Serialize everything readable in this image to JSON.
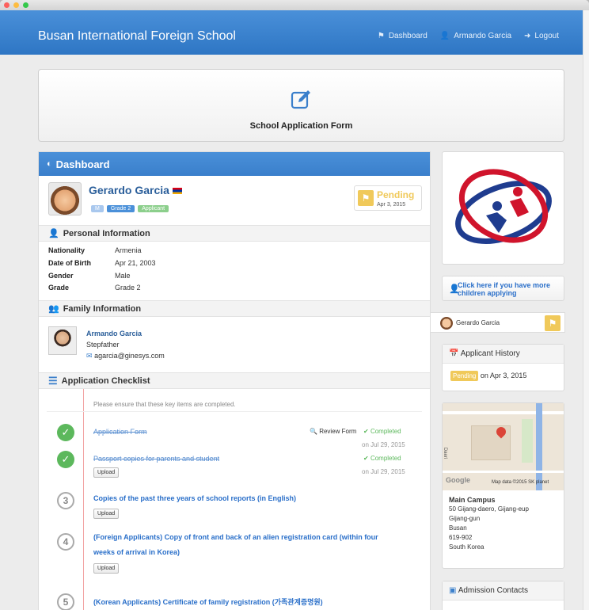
{
  "window": {
    "dot_colors": [
      "#fc605c",
      "#fdbc40",
      "#34c84a"
    ]
  },
  "navbar": {
    "brand": "Busan International Foreign School",
    "links": [
      {
        "icon": "flag-icon",
        "label": "Dashboard"
      },
      {
        "icon": "user-icon",
        "label": "Armando Garcia"
      },
      {
        "icon": "logout-icon",
        "label": "Logout"
      }
    ]
  },
  "hero": {
    "title": "School Application Form",
    "icon": "edit-icon"
  },
  "dashboard": {
    "title": "Dashboard",
    "student": {
      "name": "Gerardo Garcia",
      "tags": [
        "M",
        "Grade 2",
        "Applicant"
      ],
      "status": "Pending",
      "status_date": "Apr 3, 2015"
    },
    "personal": {
      "title": "Personal Information",
      "rows": [
        {
          "k": "Nationality",
          "v": "Armenia"
        },
        {
          "k": "Date of Birth",
          "v": "Apr 21, 2003"
        },
        {
          "k": "Gender",
          "v": "Male"
        },
        {
          "k": "Grade",
          "v": "Grade 2"
        }
      ]
    },
    "family": {
      "title": "Family Information",
      "name": "Armando Garcia",
      "relation": "Stepfather",
      "email": "agarcia@ginesys.com"
    },
    "checklist": {
      "title": "Application Checklist",
      "intro": "Please ensure that these key items are completed.",
      "review_label": "Review Form",
      "upload_label": "Upload",
      "items": [
        {
          "num": "✓",
          "title": "Application Form",
          "status": "Completed",
          "date": "on Jul 29, 2015"
        },
        {
          "num": "✓",
          "title": "Passport copies for parents and student",
          "status": "Completed",
          "date": "on Jul 29, 2015"
        },
        {
          "num": "3",
          "title": "Copies of the past three years of school reports (in English)"
        },
        {
          "num": "4",
          "title_line1": "(Foreign Applicants) Copy of front and back of an alien registration card (within four",
          "title_line2": "weeks of arrival in Korea)"
        },
        {
          "num": "5",
          "title": "(Korean Applicants) Certificate of family registration (가족관계증명원)"
        }
      ]
    }
  },
  "sidebar": {
    "more_children": "Click here if you have more children applying",
    "child_name": "Gerardo Garcia",
    "history": {
      "title": "Applicant History",
      "badge": "Pending",
      "text": "on Apr 3, 2015"
    },
    "map": {
      "credit": "Map data ©2015 SK planet",
      "street": "Daeri",
      "google": "Google"
    },
    "address": {
      "title": "Main Campus",
      "lines": [
        "50 Gijang-daero, Gijang-eup",
        "Gijang-gun",
        "Busan",
        "619-902",
        "South Korea"
      ]
    },
    "contacts": {
      "title": "Admission Contacts"
    }
  },
  "colors": {
    "accent": "#3a7fcb",
    "pending": "#f0c95a",
    "green": "#5cb85c",
    "strike_line": "#f2a3a3"
  }
}
